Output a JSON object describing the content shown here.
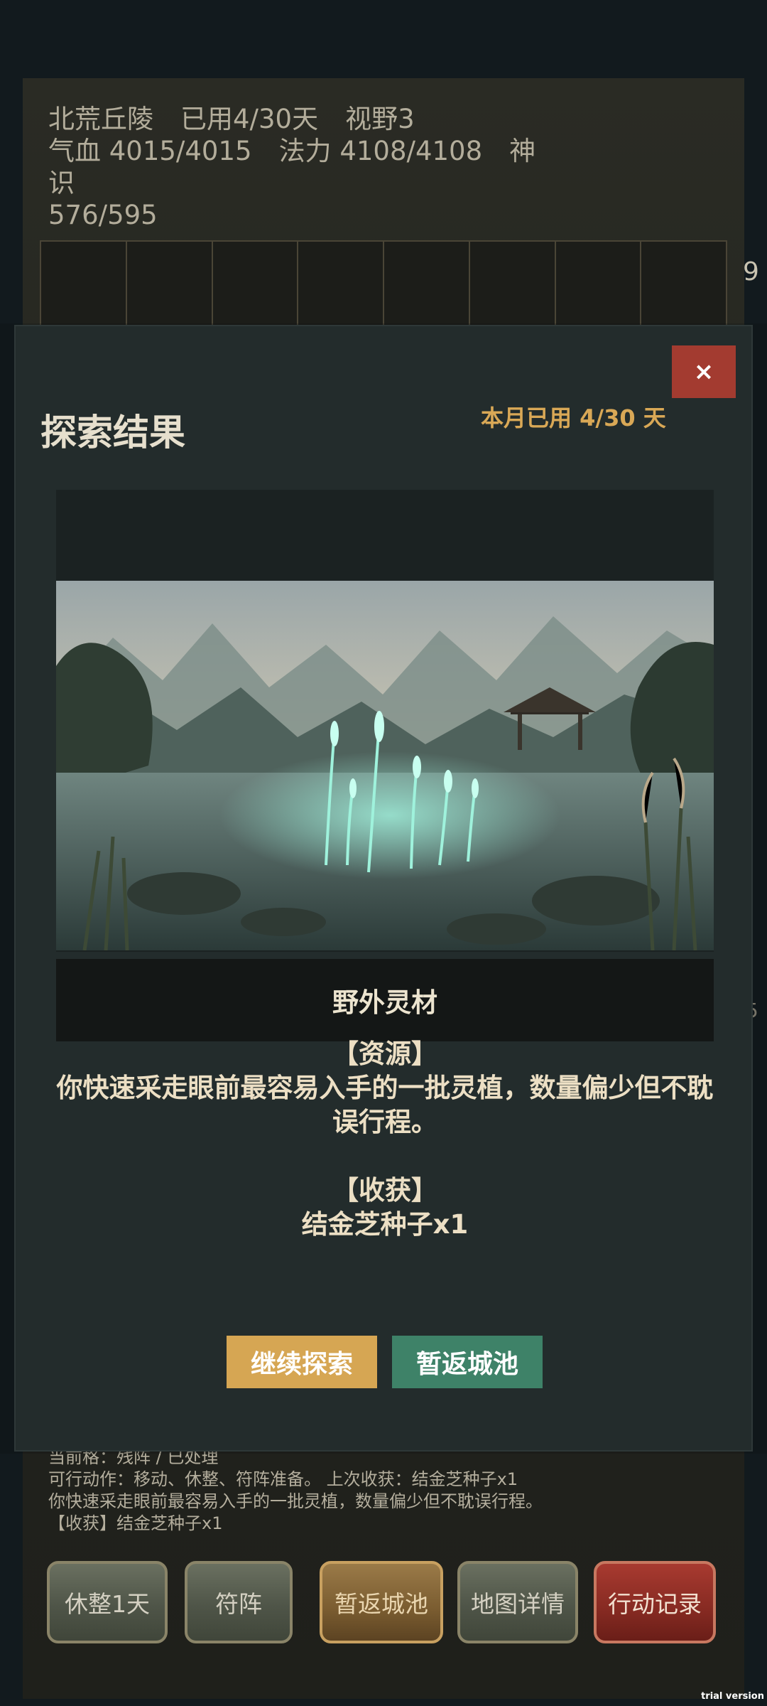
{
  "status": {
    "location": "北荒丘陵",
    "days_used": "已用4/30天",
    "vision": "视野3",
    "hp": "气血 4015/4015",
    "mp": "法力 4108/4108",
    "spirit_label": "神识",
    "spirit_value": "576/595"
  },
  "side_partial_1": "9",
  "side_partial_2": "5",
  "log": {
    "line1": "当前格：残阵 / 已处理",
    "line2": "可行动作：移动、休整、符阵准备。    上次收获：结金芝种子x1",
    "line3": "你快速采走眼前最容易入手的一批灵植，数量偏少但不耽误行程。",
    "line4": "【收获】结金芝种子x1"
  },
  "bottom_buttons": {
    "rest": "休整1天",
    "formation": "符阵",
    "return_city": "暂返城池",
    "map_detail": "地图详情",
    "action_log": "行动记录"
  },
  "modal": {
    "close": "×",
    "title": "探索结果",
    "month_used": "本月已用 4/30 天",
    "caption": "野外灵材",
    "resource_header": "【资源】",
    "resource_text": "你快速采走眼前最容易入手的一批灵植，数量偏少但不耽误行程。",
    "harvest_header": "【收获】",
    "harvest_text": "结金芝种子x1",
    "continue_label": "继续探索",
    "return_label": "暂返城池"
  },
  "watermark": "trial version",
  "colors": {
    "accent_gold": "#d6a653",
    "accent_green": "#3e8268",
    "close_red": "#a33b30",
    "month_text": "#d9a856"
  }
}
